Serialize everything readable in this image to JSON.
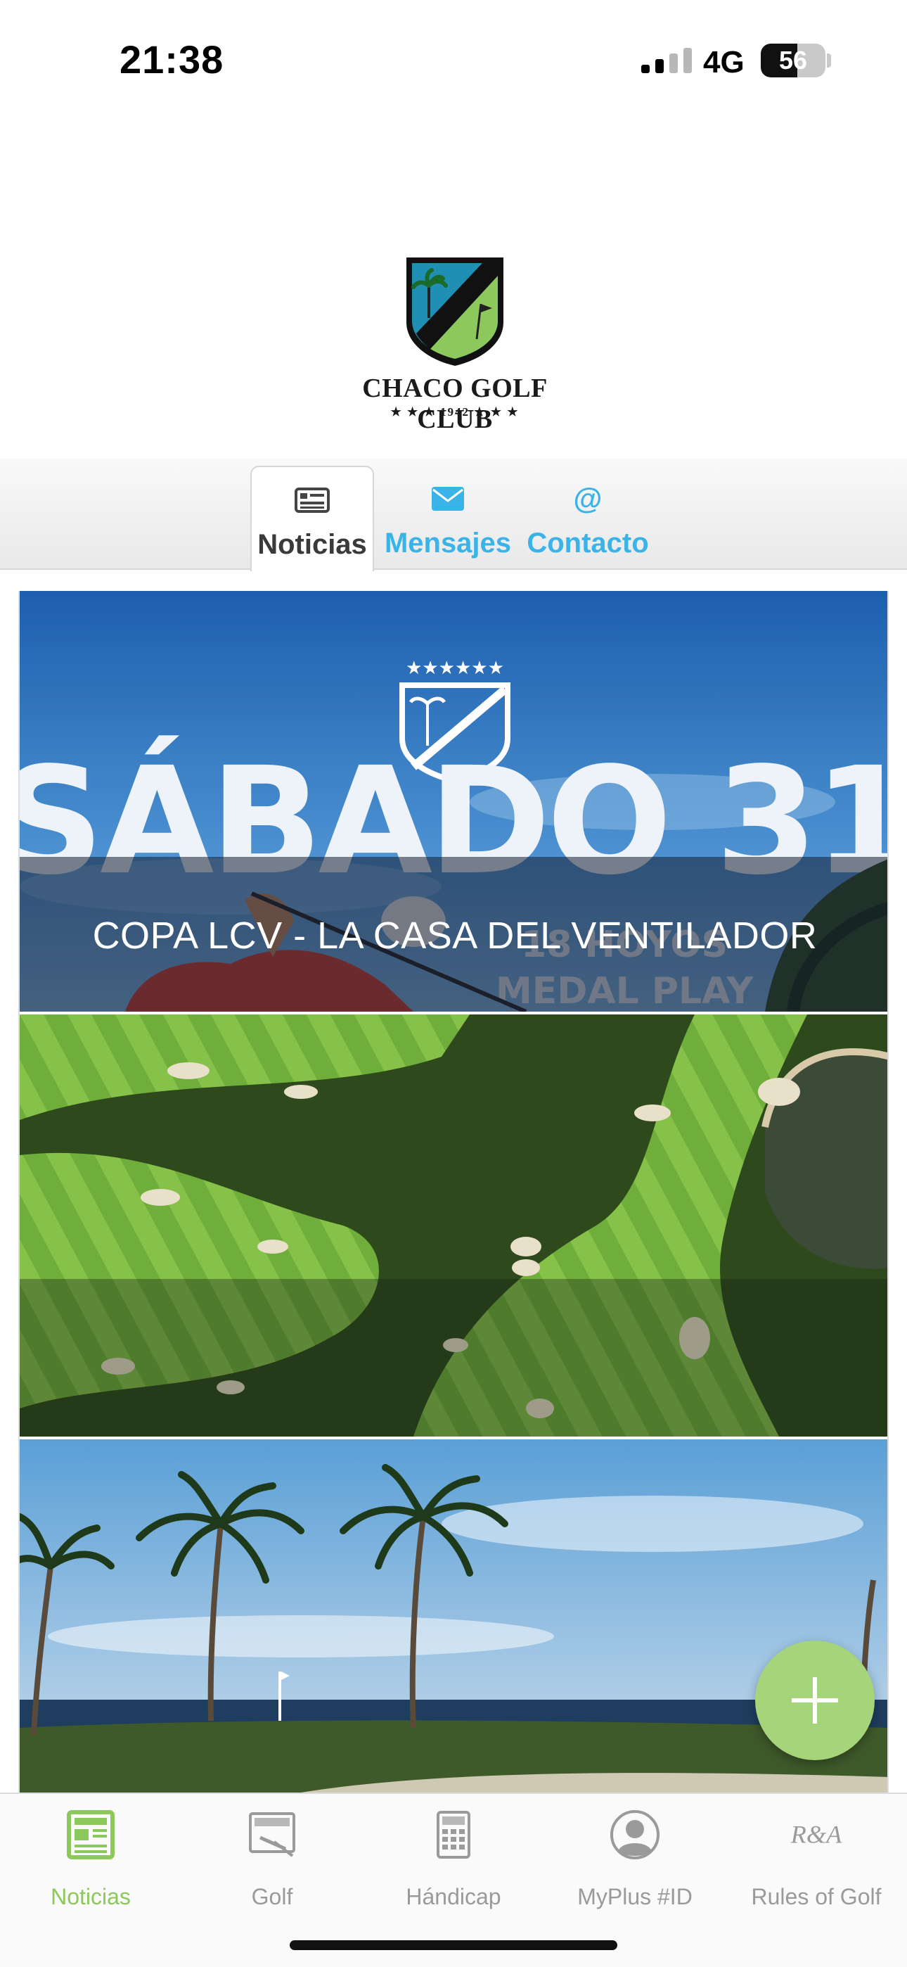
{
  "status_bar": {
    "time": "21:38",
    "network": "4G",
    "battery": "56",
    "battery_level": 0.56
  },
  "header": {
    "logo_name": "CHACO GOLF CLUB",
    "logo_sub": "★ ★ ★ 1942 ★ ★ ★"
  },
  "tabs": [
    {
      "label": "Noticias",
      "icon": "newspaper-icon",
      "active": true
    },
    {
      "label": "Mensajes",
      "icon": "envelope-icon",
      "active": false
    },
    {
      "label": "Contacto",
      "icon": "at-icon",
      "active": false
    }
  ],
  "feed": {
    "items": [
      {
        "title": "COPA LCV - LA CASA DEL VENTILADOR",
        "image": "sabado-31-poster"
      },
      {
        "title": "",
        "image": "aerial-golf-course"
      },
      {
        "title": "",
        "image": "palm-trees-beach"
      }
    ]
  },
  "fab": {
    "icon": "plus-icon"
  },
  "bottom_nav": {
    "items": [
      {
        "label": "Noticias",
        "icon": "news-icon",
        "active": true
      },
      {
        "label": "Golf",
        "icon": "scorecard-icon",
        "active": false
      },
      {
        "label": "Hándicap",
        "icon": "calculator-icon",
        "active": false
      },
      {
        "label": "MyPlus #ID",
        "icon": "user-icon",
        "active": false
      },
      {
        "label": "Rules of Golf",
        "icon": "ra-logo-icon",
        "active": false
      }
    ]
  },
  "colors": {
    "accent_green": "#8cc85c",
    "fab_green": "#a5d47a",
    "tab_blue": "#3ab4e8",
    "inactive_gray": "#9a9a9a"
  }
}
